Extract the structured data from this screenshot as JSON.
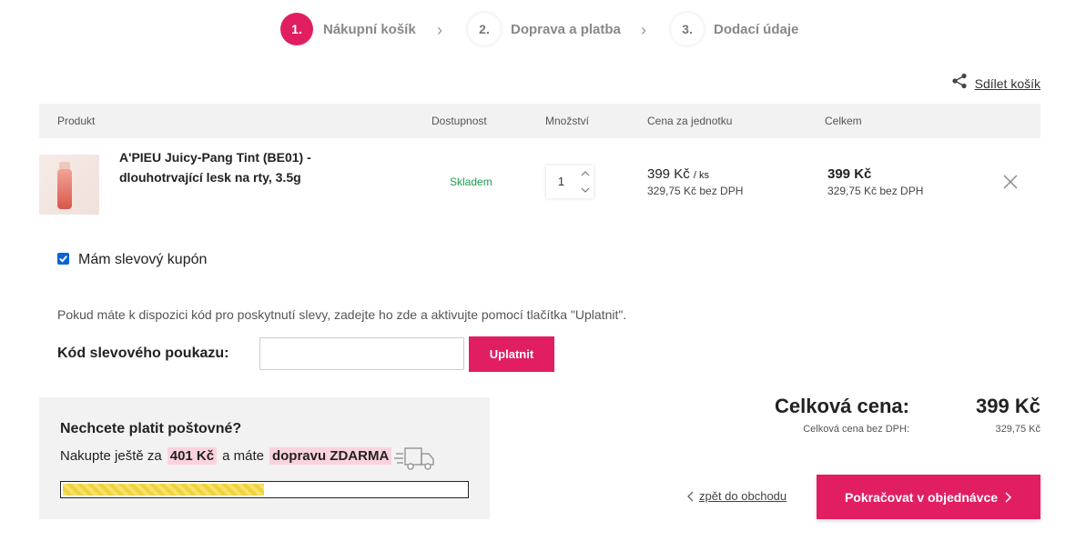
{
  "steps": [
    {
      "num": "1.",
      "label": "Nákupní košík"
    },
    {
      "num": "2.",
      "label": "Doprava a platba"
    },
    {
      "num": "3.",
      "label": "Dodací údaje"
    }
  ],
  "share": {
    "label": "Sdílet košík",
    "icon": "share-icon"
  },
  "table": {
    "headers": [
      "Produkt",
      "Dostupnost",
      "Množství",
      "Cena za jednotku",
      "Celkem"
    ]
  },
  "product": {
    "name": "A'PIEU Juicy-Pang Tint (BE01) - dlouhotrvající lesk na rty, 3.5g",
    "availability": "Skladem",
    "quantity": "1",
    "unit_price": "399 Kč",
    "unit_suffix": "/ ks",
    "unit_price_nodph": "329,75 Kč bez DPH",
    "total_price": "399 Kč",
    "total_price_nodph": "329,75 Kč bez DPH"
  },
  "coupon": {
    "checkbox_label": "Mám slevový kupón",
    "info": "Pokud máte k dispozici kód pro poskytnutí slevy, zadejte ho zde a aktivujte pomocí tlačítka \"Uplatnit\".",
    "field_label": "Kód slevového poukazu:",
    "input_value": "",
    "apply_label": "Uplatnit"
  },
  "shipping": {
    "title": "Nechcete platit poštovné?",
    "text_before": "Nakupte ještě za",
    "amount": "401 Kč",
    "text_middle": "a máte",
    "free_label": "dopravu ZDARMA",
    "progress": 0.4988
  },
  "summary": {
    "total_label": "Celková cena:",
    "total_value": "399 Kč",
    "nodph_label": "Celková cena bez DPH:",
    "nodph_value": "329,75 Kč"
  },
  "nav": {
    "back_label": "zpět do obchodu",
    "continue_label": "Pokračovat v objednávce"
  },
  "colors": {
    "accent": "#e21e62",
    "available": "#1a9d4b"
  }
}
